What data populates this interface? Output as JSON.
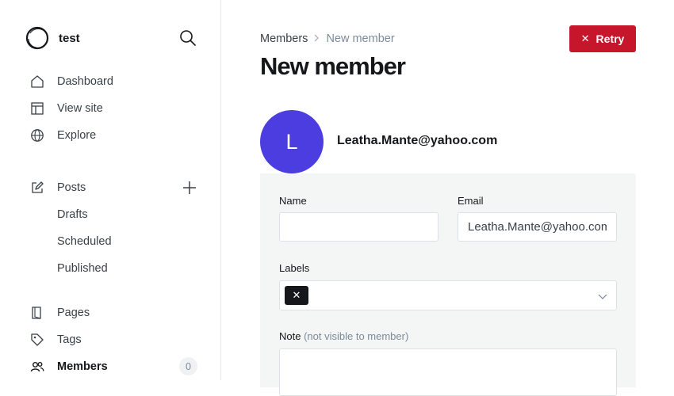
{
  "sidebar": {
    "site_name": "test",
    "nav_top": [
      {
        "label": "Dashboard",
        "icon": "home-icon"
      },
      {
        "label": "View site",
        "icon": "layout-icon"
      },
      {
        "label": "Explore",
        "icon": "globe-icon"
      }
    ],
    "posts": {
      "label": "Posts",
      "icon": "edit-icon"
    },
    "post_subitems": [
      "Drafts",
      "Scheduled",
      "Published"
    ],
    "nav_bottom": [
      {
        "label": "Pages",
        "icon": "page-icon"
      },
      {
        "label": "Tags",
        "icon": "tag-icon"
      },
      {
        "label": "Members",
        "icon": "members-icon",
        "count": "0"
      }
    ]
  },
  "header": {
    "breadcrumb_parent": "Members",
    "breadcrumb_current": "New member",
    "title": "New member",
    "retry_label": "Retry",
    "retry_color": "#c5162b"
  },
  "member": {
    "initial": "L",
    "email": "Leatha.Mante@yahoo.com",
    "avatar_color": "#4c3de1"
  },
  "form": {
    "name_label": "Name",
    "name_value": "",
    "email_label": "Email",
    "email_value": "Leatha.Mante@yahoo.com",
    "labels_label": "Labels",
    "label_chip_remove": "✕",
    "note_label": "Note",
    "note_hint": "(not visible to member)",
    "note_value": ""
  }
}
